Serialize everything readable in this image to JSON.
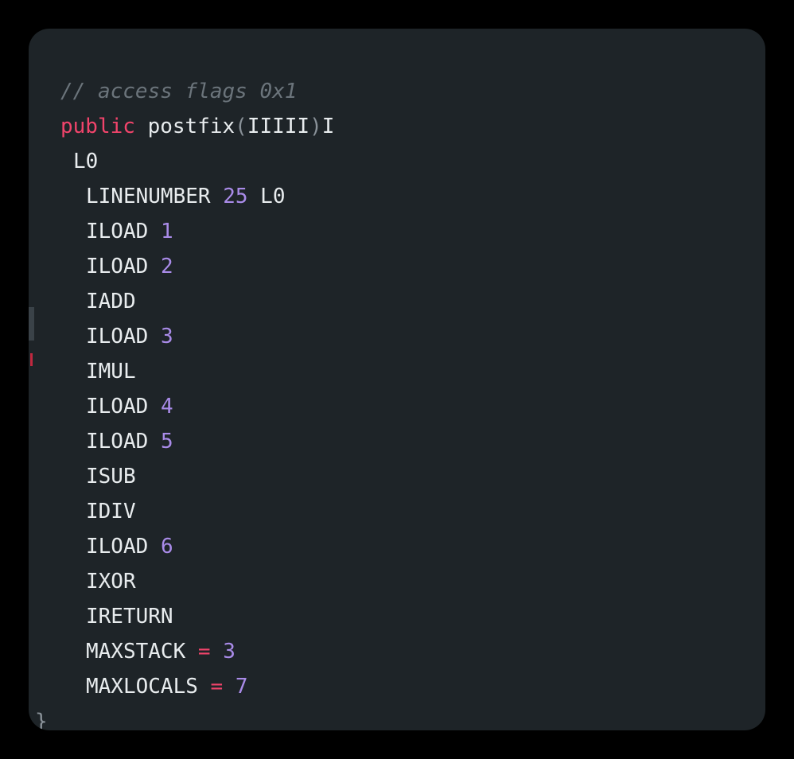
{
  "comment": "// access flags 0x1",
  "signature": {
    "keyword": "public",
    "name": "postfix",
    "open_paren": "(",
    "params": "IIIII",
    "close_paren": ")",
    "return_type": "I"
  },
  "label": "L0",
  "instructions": [
    {
      "op": "LINENUMBER",
      "arg": "25",
      "extra": "L0"
    },
    {
      "op": "ILOAD",
      "arg": "1"
    },
    {
      "op": "ILOAD",
      "arg": "2"
    },
    {
      "op": "IADD"
    },
    {
      "op": "ILOAD",
      "arg": "3"
    },
    {
      "op": "IMUL"
    },
    {
      "op": "ILOAD",
      "arg": "4"
    },
    {
      "op": "ILOAD",
      "arg": "5"
    },
    {
      "op": "ISUB"
    },
    {
      "op": "IDIV"
    },
    {
      "op": "ILOAD",
      "arg": "6"
    },
    {
      "op": "IXOR"
    },
    {
      "op": "IRETURN"
    }
  ],
  "maxstack": {
    "key": "MAXSTACK",
    "eq": "=",
    "value": "3"
  },
  "maxlocals": {
    "key": "MAXLOCALS",
    "eq": "=",
    "value": "7"
  },
  "closing_brace": "}",
  "colors": {
    "background": "#1e2428",
    "keyword": "#f1446b",
    "number": "#a98be8",
    "comment": "#6b747b",
    "text": "#e8ecee"
  }
}
